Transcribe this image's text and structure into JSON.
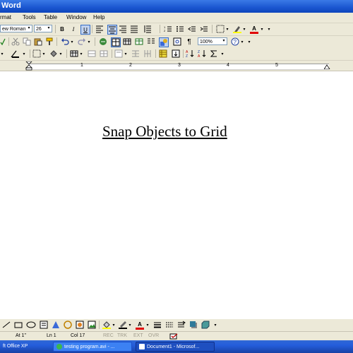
{
  "titlebar": {
    "title": "Word"
  },
  "menu": [
    "rmat",
    "Tools",
    "Table",
    "Window",
    "Help"
  ],
  "format_toolbar": {
    "font_name": "ew Roman",
    "font_size": "26",
    "bold": "B",
    "italic": "I",
    "underline": "U",
    "font_color_glyph": "A"
  },
  "standard_toolbar": {
    "zoom": "100%",
    "pilcrow": "¶"
  },
  "ruler": {
    "marks": [
      "1",
      "2",
      "3",
      "4",
      "5"
    ]
  },
  "document": {
    "heading": "Snap Objects to Grid"
  },
  "drawing_toolbar": {
    "font_color_glyph": "A"
  },
  "status_bar": {
    "at": "At  1\"",
    "ln": "Ln  1",
    "col": "Col  17",
    "rec": "REC",
    "trk": "TRK",
    "ext": "EXT",
    "ovr": "OVR"
  },
  "taskbar": {
    "items": [
      "ft Office XP",
      "testing program.avi - ...",
      "Document1 - Microsof..."
    ]
  },
  "colors": {
    "title_blue": "#1a56d0",
    "chrome": "#ece9d8",
    "taskbar_blue": "#245ddb"
  }
}
